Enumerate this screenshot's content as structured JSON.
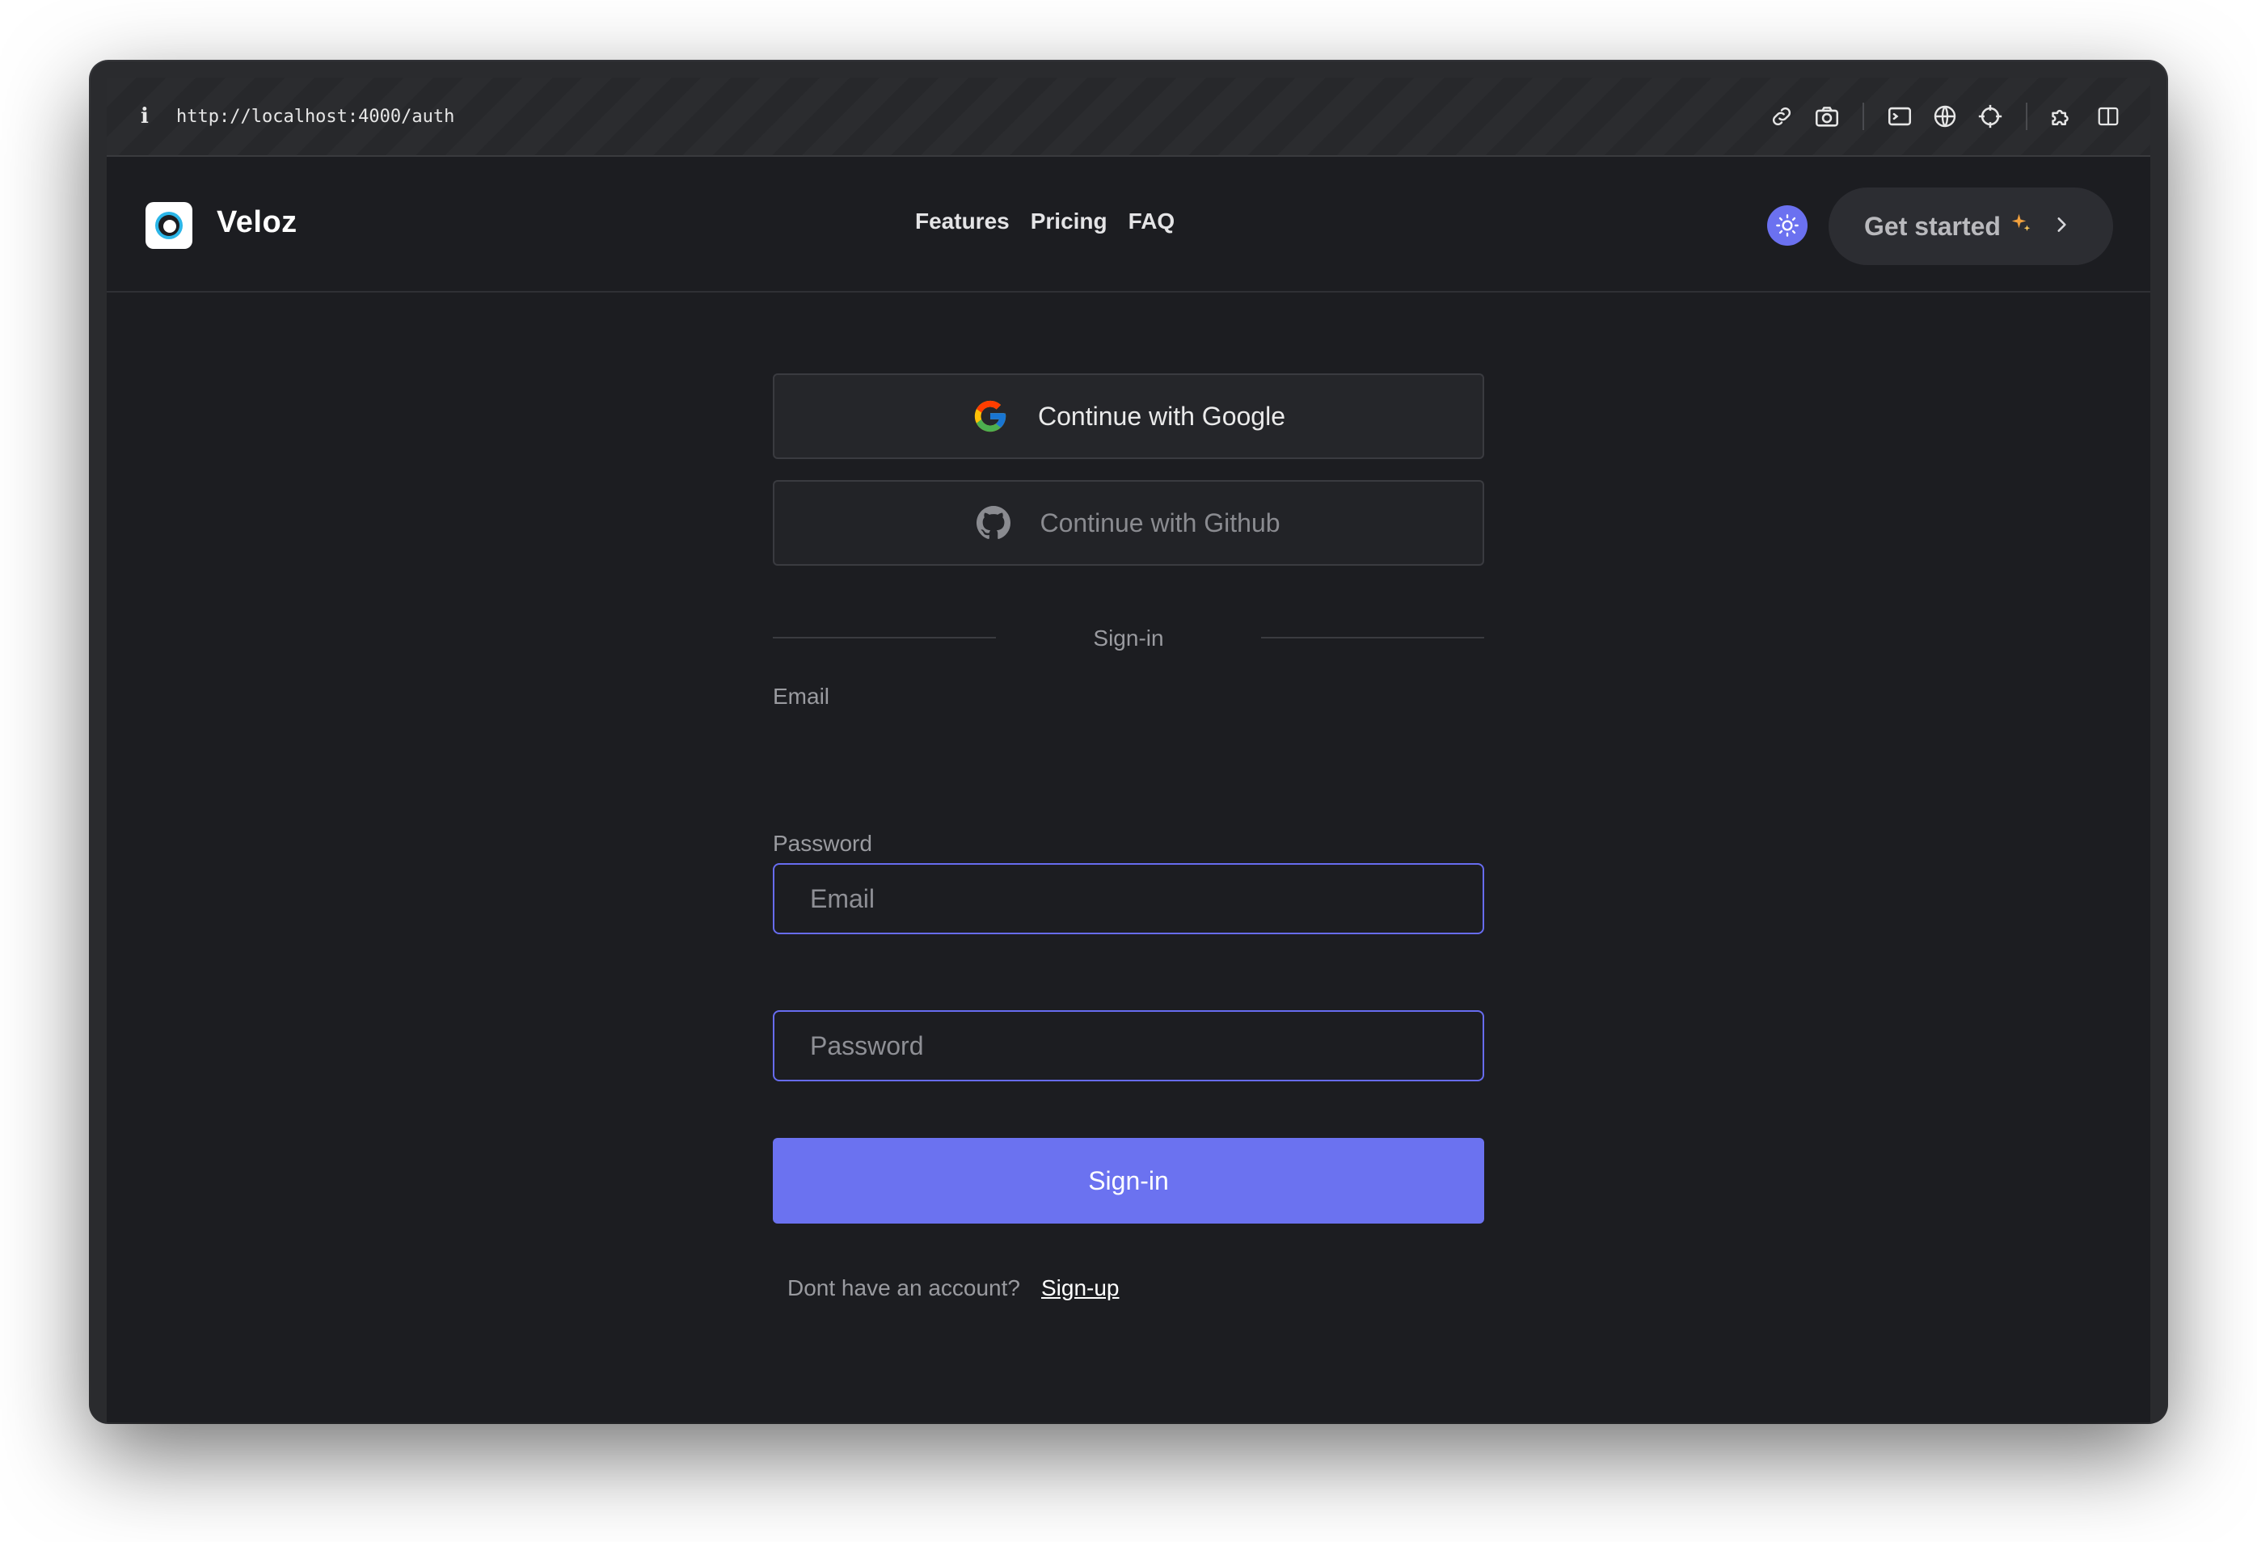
{
  "browser": {
    "url": "http://localhost:4000/auth",
    "icons": [
      "link-icon",
      "camera-icon",
      "terminal-icon",
      "globe-icon",
      "crosshair-icon",
      "extension-icon",
      "split-view-icon"
    ]
  },
  "header": {
    "brand": "Veloz",
    "nav": [
      "Features",
      "Pricing",
      "FAQ"
    ],
    "cta_label": "Get started"
  },
  "auth": {
    "google_label": "Continue with Google",
    "github_label": "Continue with Github",
    "divider_label": "Sign-in",
    "email_label": "Email",
    "email_placeholder": "Email",
    "password_label": "Password",
    "password_placeholder": "Password",
    "submit_label": "Sign-in",
    "signup_prompt": "Dont have an account?",
    "signup_link": "Sign-up"
  },
  "colors": {
    "accent": "#6b72f0",
    "background": "#1c1d21"
  }
}
